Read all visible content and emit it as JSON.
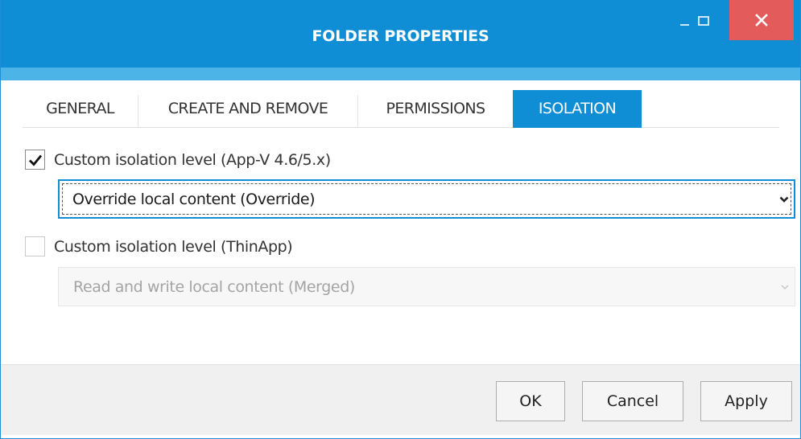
{
  "window": {
    "title": "FOLDER PROPERTIES",
    "controls": {
      "minimize": "minimize-icon",
      "maximize": "maximize-icon",
      "close": "close-icon"
    },
    "colors": {
      "accent": "#0f8ed6",
      "close": "#e35b5b",
      "footer": "#f0f0f0"
    }
  },
  "tabs": [
    {
      "label": "GENERAL",
      "active": false
    },
    {
      "label": "CREATE AND REMOVE",
      "active": false
    },
    {
      "label": "PERMISSIONS",
      "active": false
    },
    {
      "label": "ISOLATION",
      "active": true
    }
  ],
  "appv": {
    "checkbox_label": "Custom isolation level (App-V 4.6/5.x)",
    "checked": true,
    "select_value": "Override local content (Override)",
    "enabled": true
  },
  "thinapp": {
    "checkbox_label": "Custom isolation level (ThinApp)",
    "checked": false,
    "select_value": "Read and write local content (Merged)",
    "enabled": false
  },
  "footer": {
    "ok_label": "OK",
    "cancel_label": "Cancel",
    "apply_label": "Apply"
  }
}
